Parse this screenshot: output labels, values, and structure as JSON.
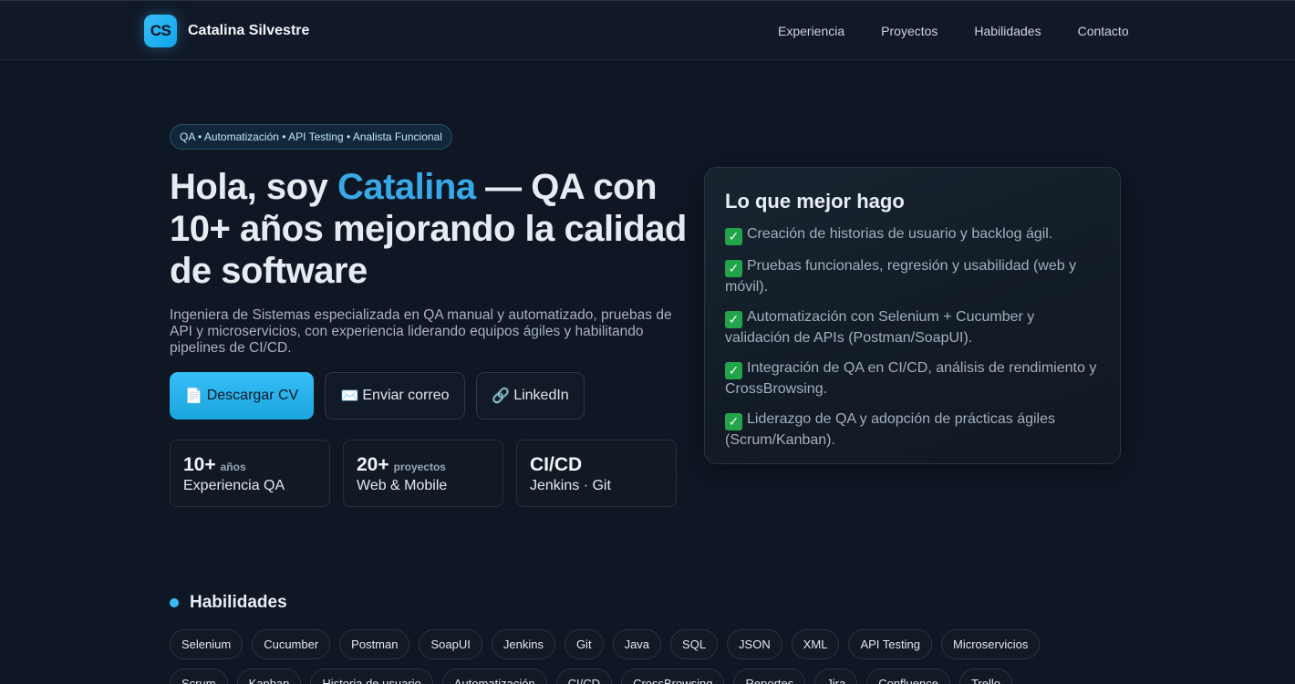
{
  "header": {
    "logo_text": "CS",
    "brand_name": "Catalina Silvestre",
    "nav": [
      "Experiencia",
      "Proyectos",
      "Habilidades",
      "Contacto"
    ]
  },
  "hero": {
    "tagline": "QA • Automatización • API Testing • Analista Funcional",
    "title_before": "Hola, soy ",
    "title_accent": "Catalina",
    "title_after": " — QA con 10+ años mejorando la calidad de software",
    "description": "Ingeniera de Sistemas especializada en QA manual y automatizado, pruebas de API y microservicios, con experiencia liderando equipos ágiles y habilitando pipelines de CI/CD.",
    "buttons": {
      "download": {
        "icon": "📄",
        "label": "Descargar CV"
      },
      "email": {
        "icon": "✉️",
        "label": "Enviar correo"
      },
      "linkedin": {
        "icon": "🔗",
        "label": "LinkedIn"
      }
    },
    "stats": [
      {
        "value": "10+",
        "unit": "años",
        "label": "Experiencia QA"
      },
      {
        "value": "20+",
        "unit": "proyectos",
        "label": "Web & Mobile"
      },
      {
        "value": "CI/CD",
        "unit": "",
        "label": "Jenkins · Git"
      }
    ]
  },
  "card": {
    "title": "Lo que mejor hago",
    "check_glyph": "✓",
    "items": [
      "Creación de historias de usuario y backlog ágil.",
      "Pruebas funcionales, regresión y usabilidad (web y móvil).",
      "Automatización con Selenium + Cucumber y validación de APIs (Postman/SoapUI).",
      "Integración de QA en CI/CD, análisis de rendimiento y CrossBrowsing.",
      "Liderazgo de QA y adopción de prácticas ágiles (Scrum/Kanban)."
    ]
  },
  "skills": {
    "title": "Habilidades",
    "chips": [
      "Selenium",
      "Cucumber",
      "Postman",
      "SoapUI",
      "Jenkins",
      "Git",
      "Java",
      "SQL",
      "JSON",
      "XML",
      "API Testing",
      "Microservicios",
      "Scrum",
      "Kanban",
      "Historia de usuario",
      "Automatización",
      "CI/CD",
      "CrossBrowsing",
      "Reportes",
      "Jira",
      "Confluence",
      "Trello"
    ]
  },
  "colors": {
    "background": "#0f1624",
    "accent": "#38bdf8",
    "check": "#22a54a"
  }
}
